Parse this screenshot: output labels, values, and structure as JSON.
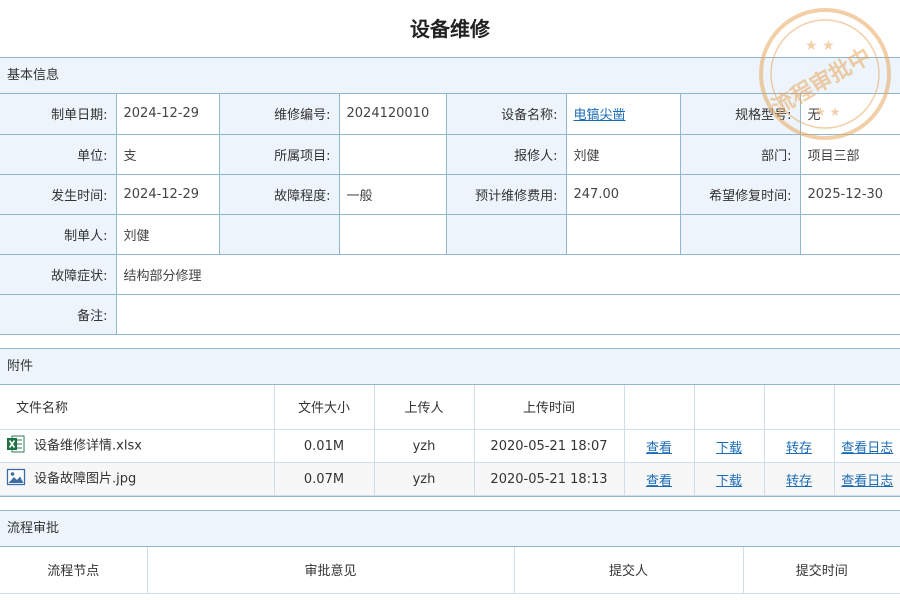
{
  "page": {
    "title": "设备维修"
  },
  "basic": {
    "section": "基本信息",
    "labels": {
      "date": "制单日期:",
      "code": "维修编号:",
      "device": "设备名称:",
      "model": "规格型号:",
      "unit": "单位:",
      "project": "所属项目:",
      "reporter": "报修人:",
      "dept": "部门:",
      "time": "发生时间:",
      "severity": "故障程度:",
      "cost": "预计维修费用:",
      "expected": "希望修复时间:",
      "creator": "制单人:",
      "symptom": "故障症状:",
      "note": "备注:"
    },
    "values": {
      "date": "2024-12-29",
      "code": "2024120010",
      "device": "电镐尖凿",
      "model": "无",
      "unit": "支",
      "project": "",
      "reporter": "刘健",
      "dept": "项目三部",
      "time": "2024-12-29",
      "severity": "一般",
      "cost": "247.00",
      "expected": "2025-12-30",
      "creator": "刘健",
      "symptom": "结构部分修理",
      "note": ""
    }
  },
  "attachments": {
    "section": "附件",
    "headers": {
      "name": "文件名称",
      "size": "文件大小",
      "uploader": "上传人",
      "time": "上传时间"
    },
    "rows": [
      {
        "icon": "excel-file-icon",
        "name": "设备维修详情.xlsx",
        "size": "0.01M",
        "uploader": "yzh",
        "time": "2020-05-21 18:07",
        "actions": {
          "view": "查看",
          "download": "下载",
          "save": "转存",
          "log": "查看日志"
        }
      },
      {
        "icon": "image-file-icon",
        "name": "设备故障图片.jpg",
        "size": "0.07M",
        "uploader": "yzh",
        "time": "2020-05-21 18:13",
        "actions": {
          "view": "查看",
          "download": "下载",
          "save": "转存",
          "log": "查看日志"
        }
      }
    ]
  },
  "flow": {
    "section": "流程审批",
    "headers": {
      "node": "流程节点",
      "opinion": "审批意见",
      "submitter": "提交人",
      "time": "提交时间"
    }
  },
  "stamp": {
    "text": "流程审批中",
    "color": "#e8a860"
  }
}
